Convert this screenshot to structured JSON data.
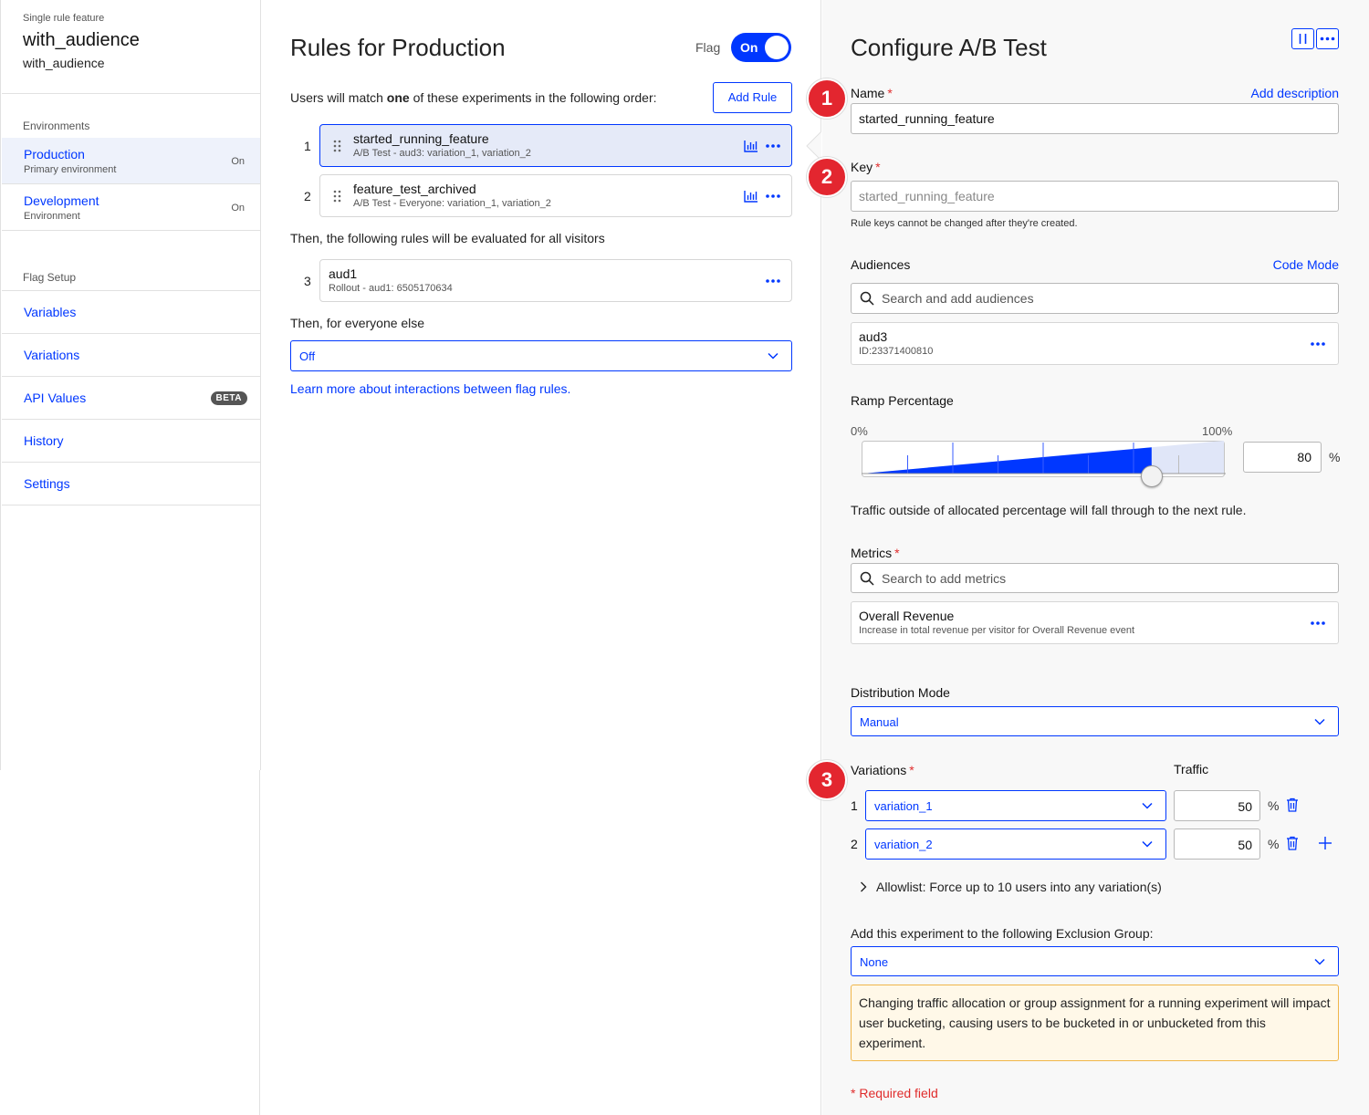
{
  "sidebar": {
    "kicker": "Single rule feature",
    "title": "with_audience",
    "subtitle": "with_audience",
    "environments_label": "Environments",
    "environments": [
      {
        "name": "Production",
        "desc": "Primary environment",
        "status": "On"
      },
      {
        "name": "Development",
        "desc": "Environment",
        "status": "On"
      }
    ],
    "flag_setup_label": "Flag Setup",
    "setup_items": [
      {
        "label": "Variables"
      },
      {
        "label": "Variations"
      },
      {
        "label": "API Values",
        "badge": "BETA"
      },
      {
        "label": "History"
      },
      {
        "label": "Settings"
      }
    ]
  },
  "rules": {
    "title": "Rules for Production",
    "flag_label": "Flag",
    "toggle_label": "On",
    "match_text_pre": "Users will match ",
    "match_text_bold": "one",
    "match_text_post": " of these experiments in the following order:",
    "add_rule": "Add Rule",
    "experiments": [
      {
        "num": "1",
        "name": "started_running_feature",
        "sub": "A/B Test - aud3: variation_1, variation_2"
      },
      {
        "num": "2",
        "name": "feature_test_archived",
        "sub": "A/B Test - Everyone: variation_1, variation_2"
      }
    ],
    "then_all": "Then, the following rules will be evaluated for all visitors",
    "rollouts": [
      {
        "num": "3",
        "name": "aud1",
        "sub": "Rollout - aud1: 6505170634"
      }
    ],
    "then_else": "Then, for everyone else",
    "else_value": "Off",
    "learn_more": "Learn more about interactions between flag rules."
  },
  "config": {
    "title": "Configure A/B Test",
    "badges": [
      "1",
      "2",
      "3"
    ],
    "name_label": "Name",
    "required_mark": "*",
    "add_description": "Add description",
    "name_value": "started_running_feature",
    "key_label": "Key",
    "key_placeholder": "started_running_feature",
    "key_helper": "Rule keys cannot be changed after they're created.",
    "audiences_label": "Audiences",
    "code_mode": "Code Mode",
    "audience_search_placeholder": "Search and add audiences",
    "audience": {
      "name": "aud3",
      "id": "ID:23371400810"
    },
    "ramp_label": "Ramp Percentage",
    "ramp_min": "0%",
    "ramp_max": "100%",
    "ramp_value": "80",
    "ramp_fraction": 0.8,
    "percent_sign": "%",
    "ramp_note": "Traffic outside of allocated percentage will fall through to the next rule.",
    "metrics_label": "Metrics",
    "metrics_search_placeholder": "Search to add metrics",
    "metric": {
      "name": "Overall Revenue",
      "desc": "Increase in total revenue per visitor for Overall Revenue event"
    },
    "distribution_label": "Distribution Mode",
    "distribution_value": "Manual",
    "variations_label": "Variations",
    "traffic_label": "Traffic",
    "variations": [
      {
        "num": "1",
        "name": "variation_1",
        "traffic": "50"
      },
      {
        "num": "2",
        "name": "variation_2",
        "traffic": "50"
      }
    ],
    "allowlist": "Allowlist: Force up to 10 users into any variation(s)",
    "exclusion_label": "Add this experiment to the following Exclusion Group:",
    "exclusion_value": "None",
    "warning": "Changing traffic allocation or group assignment for a running experiment will impact user bucketing, causing users to be bucketed in or unbucketed from this experiment.",
    "required_note": "* Required field"
  },
  "colors": {
    "accent": "#0037ff",
    "required": "#e02c2c",
    "badge": "#e3262f",
    "selected_row": "#e5eaf8",
    "warning_bg": "#fff8e8",
    "warning_border": "#f0b64a"
  },
  "icons": [
    "grip-icon",
    "chart-icon",
    "more-dots-icon",
    "chevron-down-icon",
    "search-icon",
    "trash-icon",
    "plus-icon",
    "chevron-right-icon",
    "columns-icon"
  ]
}
